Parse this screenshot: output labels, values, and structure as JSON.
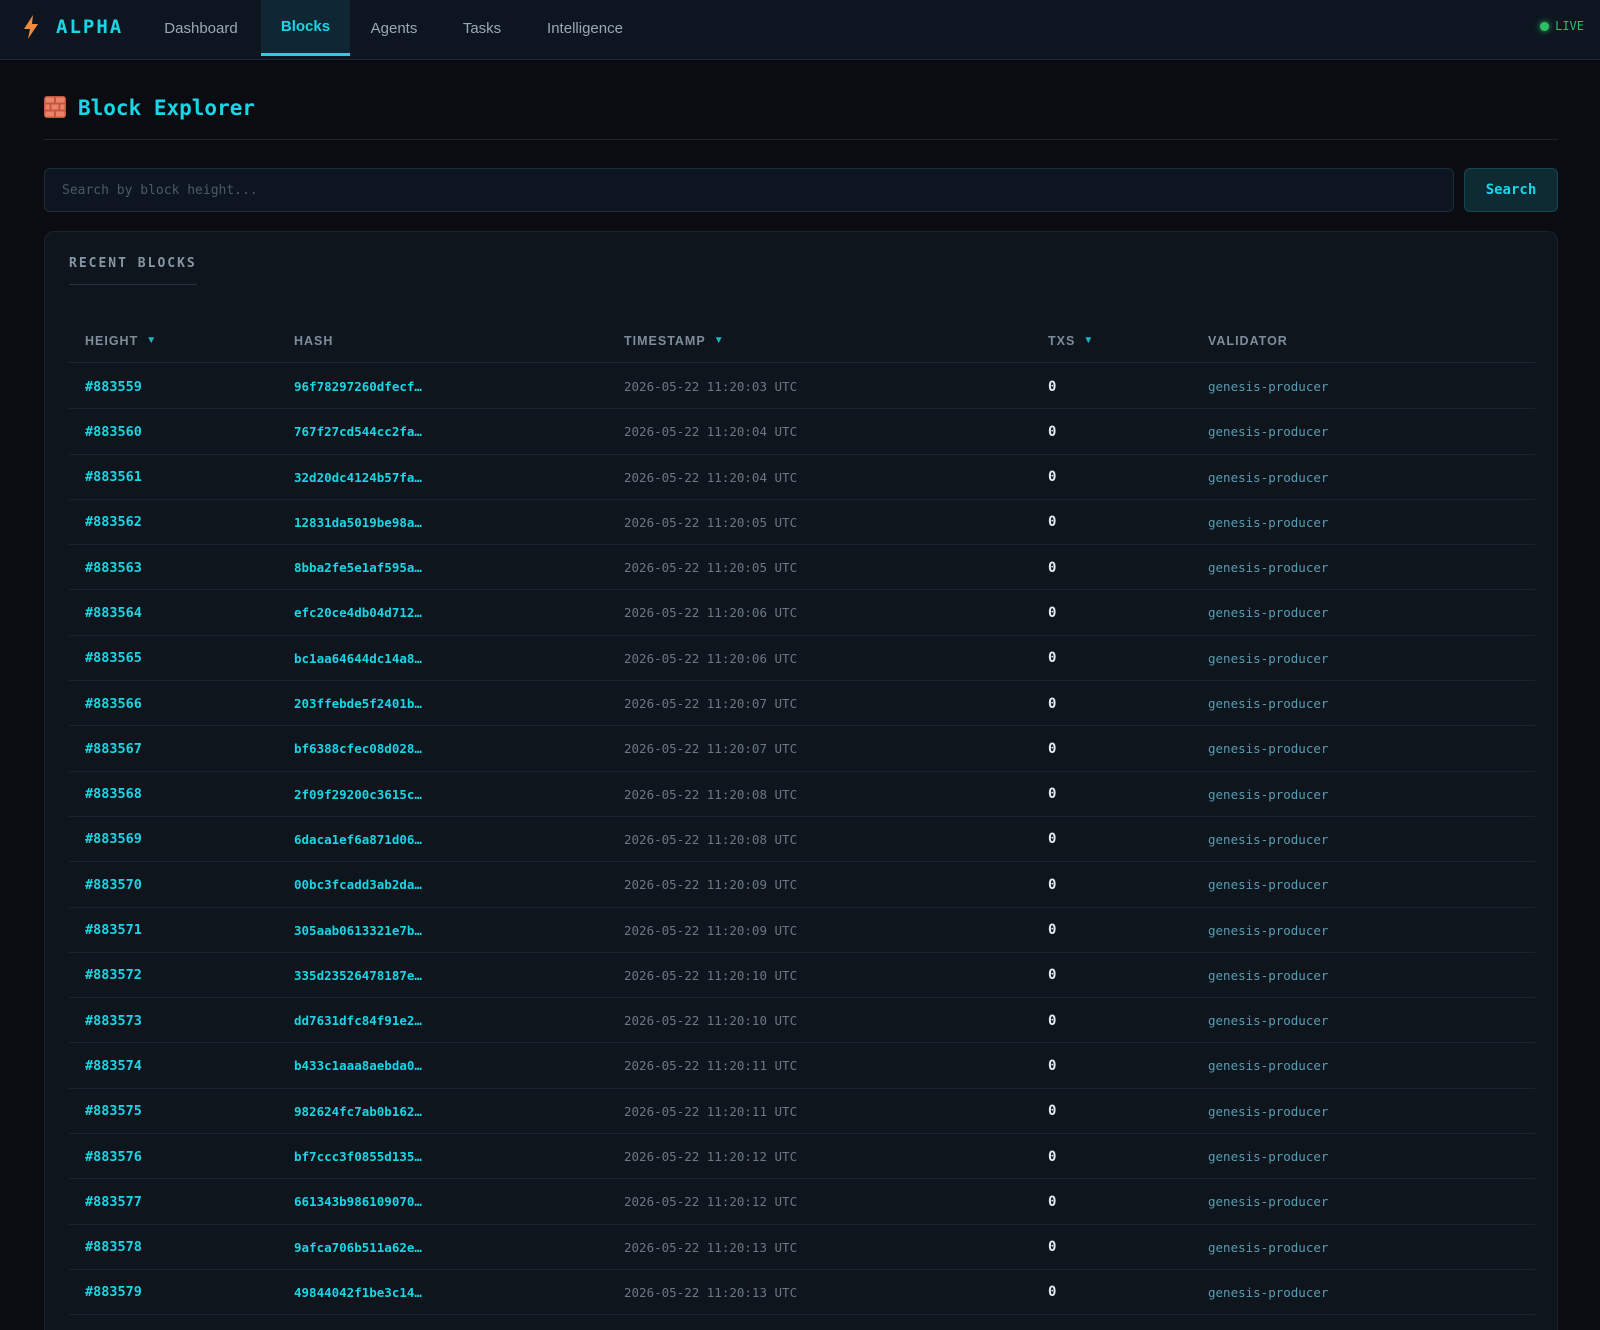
{
  "brand": {
    "name": "ALPHA",
    "icon": "lightning-bolt-icon",
    "accent": "#19d6e6",
    "icon_color": "#f08a3c"
  },
  "nav": {
    "tabs": [
      {
        "label": "Dashboard",
        "active": false
      },
      {
        "label": "Blocks",
        "active": true
      },
      {
        "label": "Agents",
        "active": false
      },
      {
        "label": "Tasks",
        "active": false
      },
      {
        "label": "Intelligence",
        "active": false
      }
    ],
    "status": {
      "label": "LIVE",
      "color": "#2dbf62"
    }
  },
  "page": {
    "title": "Block Explorer",
    "icon": "brick-wall-icon"
  },
  "search": {
    "placeholder": "Search by block height...",
    "value": "",
    "button_label": "Search"
  },
  "recent_blocks": {
    "title": "RECENT BLOCKS",
    "columns": [
      {
        "label": "HEIGHT",
        "sortable": true
      },
      {
        "label": "HASH",
        "sortable": false
      },
      {
        "label": "TIMESTAMP",
        "sortable": true
      },
      {
        "label": "TXS",
        "sortable": true
      },
      {
        "label": "VALIDATOR",
        "sortable": false
      }
    ],
    "rows": [
      {
        "height": "#883559",
        "hash": "96f78297260dfecf…",
        "timestamp": "2026-05-22 11:20:03 UTC",
        "txs": "0",
        "validator": "genesis-producer"
      },
      {
        "height": "#883560",
        "hash": "767f27cd544cc2fa…",
        "timestamp": "2026-05-22 11:20:04 UTC",
        "txs": "0",
        "validator": "genesis-producer"
      },
      {
        "height": "#883561",
        "hash": "32d20dc4124b57fa…",
        "timestamp": "2026-05-22 11:20:04 UTC",
        "txs": "0",
        "validator": "genesis-producer"
      },
      {
        "height": "#883562",
        "hash": "12831da5019be98a…",
        "timestamp": "2026-05-22 11:20:05 UTC",
        "txs": "0",
        "validator": "genesis-producer"
      },
      {
        "height": "#883563",
        "hash": "8bba2fe5e1af595a…",
        "timestamp": "2026-05-22 11:20:05 UTC",
        "txs": "0",
        "validator": "genesis-producer"
      },
      {
        "height": "#883564",
        "hash": "efc20ce4db04d712…",
        "timestamp": "2026-05-22 11:20:06 UTC",
        "txs": "0",
        "validator": "genesis-producer"
      },
      {
        "height": "#883565",
        "hash": "bc1aa64644dc14a8…",
        "timestamp": "2026-05-22 11:20:06 UTC",
        "txs": "0",
        "validator": "genesis-producer"
      },
      {
        "height": "#883566",
        "hash": "203ffebde5f2401b…",
        "timestamp": "2026-05-22 11:20:07 UTC",
        "txs": "0",
        "validator": "genesis-producer"
      },
      {
        "height": "#883567",
        "hash": "bf6388cfec08d028…",
        "timestamp": "2026-05-22 11:20:07 UTC",
        "txs": "0",
        "validator": "genesis-producer"
      },
      {
        "height": "#883568",
        "hash": "2f09f29200c3615c…",
        "timestamp": "2026-05-22 11:20:08 UTC",
        "txs": "0",
        "validator": "genesis-producer"
      },
      {
        "height": "#883569",
        "hash": "6daca1ef6a871d06…",
        "timestamp": "2026-05-22 11:20:08 UTC",
        "txs": "0",
        "validator": "genesis-producer"
      },
      {
        "height": "#883570",
        "hash": "00bc3fcadd3ab2da…",
        "timestamp": "2026-05-22 11:20:09 UTC",
        "txs": "0",
        "validator": "genesis-producer"
      },
      {
        "height": "#883571",
        "hash": "305aab0613321e7b…",
        "timestamp": "2026-05-22 11:20:09 UTC",
        "txs": "0",
        "validator": "genesis-producer"
      },
      {
        "height": "#883572",
        "hash": "335d23526478187e…",
        "timestamp": "2026-05-22 11:20:10 UTC",
        "txs": "0",
        "validator": "genesis-producer"
      },
      {
        "height": "#883573",
        "hash": "dd7631dfc84f91e2…",
        "timestamp": "2026-05-22 11:20:10 UTC",
        "txs": "0",
        "validator": "genesis-producer"
      },
      {
        "height": "#883574",
        "hash": "b433c1aaa8aebda0…",
        "timestamp": "2026-05-22 11:20:11 UTC",
        "txs": "0",
        "validator": "genesis-producer"
      },
      {
        "height": "#883575",
        "hash": "982624fc7ab0b162…",
        "timestamp": "2026-05-22 11:20:11 UTC",
        "txs": "0",
        "validator": "genesis-producer"
      },
      {
        "height": "#883576",
        "hash": "bf7ccc3f0855d135…",
        "timestamp": "2026-05-22 11:20:12 UTC",
        "txs": "0",
        "validator": "genesis-producer"
      },
      {
        "height": "#883577",
        "hash": "661343b986109070…",
        "timestamp": "2026-05-22 11:20:12 UTC",
        "txs": "0",
        "validator": "genesis-producer"
      },
      {
        "height": "#883578",
        "hash": "9afca706b511a62e…",
        "timestamp": "2026-05-22 11:20:13 UTC",
        "txs": "0",
        "validator": "genesis-producer"
      },
      {
        "height": "#883579",
        "hash": "49844042f1be3c14…",
        "timestamp": "2026-05-22 11:20:13 UTC",
        "txs": "0",
        "validator": "genesis-producer"
      }
    ]
  }
}
